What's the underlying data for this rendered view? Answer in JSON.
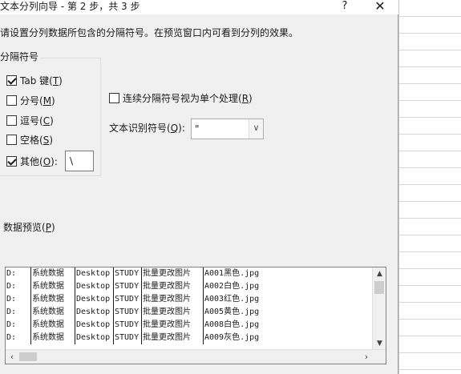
{
  "window": {
    "title": "文本分列向导 - 第 2 步，共 3 步",
    "help": "?",
    "close": "✕"
  },
  "instruction": "请设置分列数据所包含的分隔符号。在预览窗口内可看到分列的效果。",
  "delimiters": {
    "group_title": "分隔符号",
    "tab": {
      "label": "Tab 键(",
      "key": "T",
      "suffix": ")",
      "checked": true
    },
    "semicolon": {
      "label": "分号(",
      "key": "M",
      "suffix": ")",
      "checked": false
    },
    "comma": {
      "label": "逗号(",
      "key": "C",
      "suffix": ")",
      "checked": false
    },
    "space": {
      "label": "空格(",
      "key": "S",
      "suffix": ")",
      "checked": false
    },
    "other": {
      "label": "其他(",
      "key": "O",
      "suffix": "):",
      "checked": true,
      "value": "\\"
    }
  },
  "consecutive": {
    "label": "连续分隔符号视为单个处理(",
    "key": "R",
    "suffix": ")",
    "checked": false
  },
  "text_qualifier": {
    "label": "文本识别符号(",
    "key": "Q",
    "suffix": "):",
    "value": "\""
  },
  "preview": {
    "title_text": "数据预览(",
    "title_key": "P",
    "title_suffix": ")",
    "rows": [
      [
        "D:",
        "系统数据",
        "Desktop",
        "STUDY",
        "批量更改图片",
        "A001黑色.jpg"
      ],
      [
        "D:",
        "系统数据",
        "Desktop",
        "STUDY",
        "批量更改图片",
        "A002白色.jpg"
      ],
      [
        "D:",
        "系统数据",
        "Desktop",
        "STUDY",
        "批量更改图片",
        "A003红色.jpg"
      ],
      [
        "D:",
        "系统数据",
        "Desktop",
        "STUDY",
        "批量更改图片",
        "A005黄色.jpg"
      ],
      [
        "D:",
        "系统数据",
        "Desktop",
        "STUDY",
        "批量更改图片",
        "A008白色.jpg"
      ],
      [
        "D:",
        "系统数据",
        "Desktop",
        "STUDY",
        "批量更改图片",
        "A009灰色.jpg"
      ]
    ]
  }
}
